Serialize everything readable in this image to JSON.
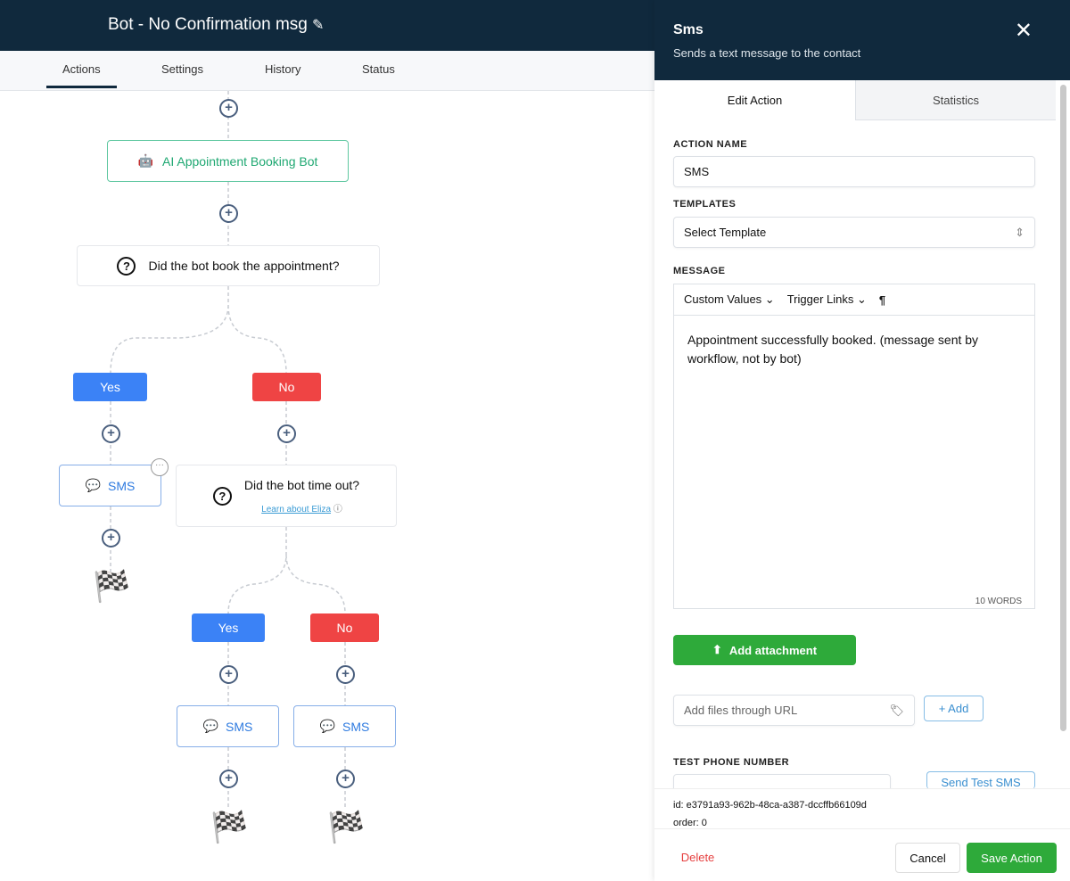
{
  "header": {
    "title": "Bot - No Confirmation msg"
  },
  "tabs": [
    "Actions",
    "Settings",
    "History",
    "Status"
  ],
  "flow": {
    "bot_node": "AI Appointment Booking Bot",
    "question1": "Did the bot book the appointment?",
    "yes": "Yes",
    "no": "No",
    "sms": "SMS",
    "question2": "Did the bot time out?",
    "learn_link": "Learn about Eliza"
  },
  "panel": {
    "title": "Sms",
    "subtitle": "Sends a text message to the contact",
    "tabs": [
      "Edit Action",
      "Statistics"
    ],
    "action_name_label": "ACTION NAME",
    "action_name": "SMS",
    "templates_label": "TEMPLATES",
    "template_value": "Select Template",
    "message_label": "MESSAGE",
    "custom_values": "Custom Values",
    "trigger_links": "Trigger Links",
    "message": "Appointment successfully booked. (message sent by workflow, not by bot)",
    "word_count": "10 WORDS",
    "add_attachment": "Add attachment",
    "url_placeholder": "Add files through URL",
    "add_button": "+ Add",
    "test_phone_label": "TEST PHONE NUMBER",
    "send_test": "Send Test SMS",
    "id": "id: e3791a93-962b-48ca-a387-dccffb66109d",
    "order": "order: 0",
    "delete": "Delete",
    "cancel": "Cancel",
    "save": "Save Action"
  }
}
